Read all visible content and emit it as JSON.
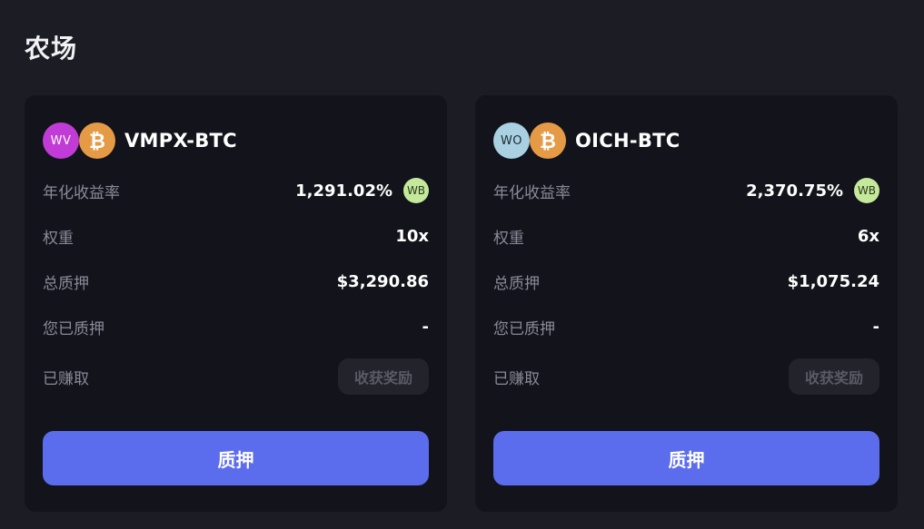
{
  "page": {
    "title": "农场"
  },
  "labels": {
    "apr": "年化收益率",
    "weight": "权重",
    "total_staked": "总质押",
    "your_staked": "您已质押",
    "earned": "已赚取",
    "harvest": "收获奖励",
    "stake": "质押",
    "reward_token": "WB"
  },
  "farms": [
    {
      "token_a": "WV",
      "token_a_color": "#c13bd6",
      "token_a_text_color": "#ffffff",
      "token_b_icon": "bitcoin-icon",
      "pair": "VMPX-BTC",
      "apr": "1,291.02%",
      "weight": "10x",
      "total_staked": "$3,290.86",
      "your_staked": "-"
    },
    {
      "token_a": "WO",
      "token_a_color": "#a9d1e2",
      "token_a_text_color": "#1c2a33",
      "token_b_icon": "bitcoin-icon",
      "pair": "OICH-BTC",
      "apr": "2,370.75%",
      "weight": "6x",
      "total_staked": "$1,075.24",
      "your_staked": "-"
    }
  ],
  "colors": {
    "background": "#1c1c24",
    "card": "#13131b",
    "accent": "#5b6ded",
    "bitcoin": "#e59a45",
    "reward_badge": "#c5e99a"
  }
}
